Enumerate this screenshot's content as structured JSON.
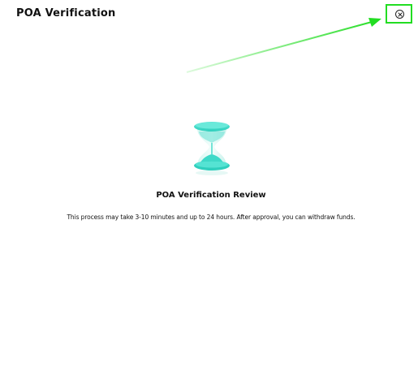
{
  "modal": {
    "title": "POA Verification"
  },
  "status": {
    "title": "POA Verification Review",
    "description": "This process may take 3-10 minutes and up to 24 hours. After approval, you can withdraw funds."
  },
  "icons": {
    "close": "close-circle-icon",
    "hourglass": "hourglass-icon"
  },
  "colors": {
    "accent": "#3fd9c8",
    "highlight": "#22dd22"
  }
}
